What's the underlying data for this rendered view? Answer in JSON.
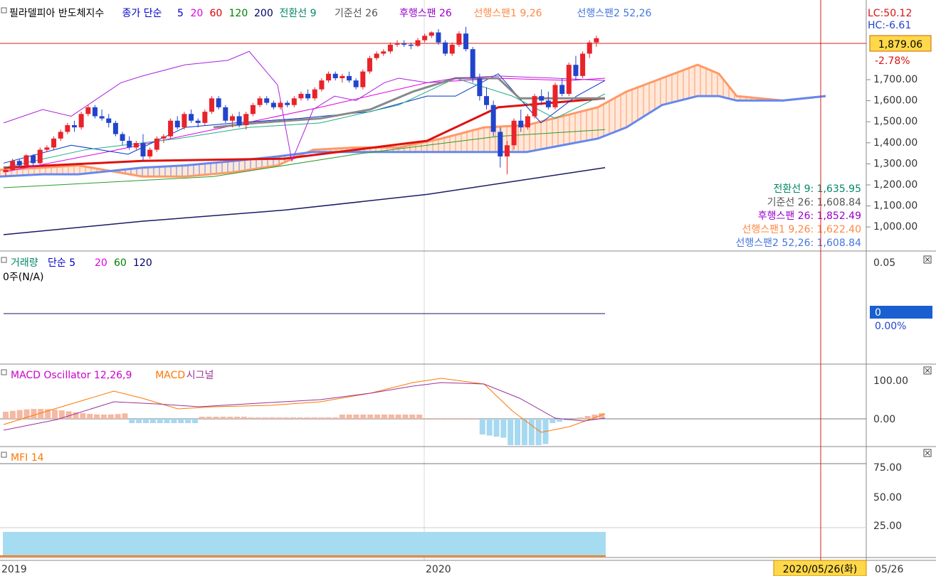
{
  "panes": {
    "price": {
      "legend": [
        {
          "text": "필라델피아 반도체지수",
          "color": "#000000"
        },
        {
          "text": "종가 단순",
          "color": "#0000cc"
        },
        {
          "text": "5",
          "color": "#0000cc"
        },
        {
          "text": "20",
          "color": "#e000e0"
        },
        {
          "text": "60",
          "color": "#e00000"
        },
        {
          "text": "120",
          "color": "#008000"
        },
        {
          "text": "200",
          "color": "#000066"
        },
        {
          "text": "전환선 9",
          "color": "#008866"
        },
        {
          "text": "기준선 26",
          "color": "#555555"
        },
        {
          "text": "후행스팬 26",
          "color": "#9900cc"
        },
        {
          "text": "선행스팬1 9,26",
          "color": "#ff8844"
        },
        {
          "text": "선행스팬2 52,26",
          "color": "#4477dd"
        }
      ],
      "lc": "LC:50.12",
      "hc": "HC:-6.61",
      "current_price": "1,879.06",
      "change_pct": "-2.78%",
      "y_ticks": [
        "1,700.00",
        "1,600.00",
        "1,500.00",
        "1,400.00",
        "1,300.00",
        "1,200.00",
        "1,100.00",
        "1,000.00"
      ],
      "values_box": [
        {
          "text": "전환선 9: 1,635.95",
          "color": "#008866"
        },
        {
          "text": "기준선 26: 1,608.84",
          "color": "#555555"
        },
        {
          "text": "후행스팬 26: 1,852.49",
          "color": "#9900cc"
        },
        {
          "text": "선행스팬1 9,26: 1,622.40",
          "color": "#ff8844"
        },
        {
          "text": "선행스팬2 52,26: 1,608.84",
          "color": "#4477dd"
        }
      ]
    },
    "volume": {
      "legend": [
        {
          "text": "거래량",
          "color": "#008866"
        },
        {
          "text": "단순 5",
          "color": "#0000cc"
        },
        {
          "text": "20",
          "color": "#e000e0"
        },
        {
          "text": "60",
          "color": "#008000"
        },
        {
          "text": "120",
          "color": "#000066"
        }
      ],
      "sub": "0주(N/A)",
      "y_tick": "0.05",
      "current": "0",
      "pct": "0.00%"
    },
    "macd": {
      "legend": [
        {
          "text": "MACD Oscillator 12,26,9",
          "color": "#cc00cc"
        },
        {
          "text": "MACD",
          "color": "#ff7700"
        },
        {
          "text": "시그널",
          "color": "#993399"
        }
      ],
      "y_ticks": [
        "100.00",
        "0.00"
      ]
    },
    "mfi": {
      "legend": [
        {
          "text": "MFI 14",
          "color": "#ff7700"
        }
      ],
      "y_ticks": [
        "75.00",
        "50.00",
        "25.00"
      ]
    }
  },
  "x_axis": {
    "labels": [
      "2019",
      "2020"
    ],
    "cursor_date": "2020/05/26(화)",
    "right_label": "05/26"
  },
  "colors": {
    "up": "#e8232a",
    "down": "#2244cc",
    "cursor": "#d02020",
    "grid": "#d8d8d8"
  },
  "chart_data": {
    "type": "candlestick",
    "candles": [
      [
        1280,
        1300,
        1260,
        1290
      ],
      [
        1290,
        1340,
        1285,
        1330
      ],
      [
        1330,
        1340,
        1300,
        1310
      ],
      [
        1310,
        1360,
        1300,
        1355
      ],
      [
        1355,
        1360,
        1310,
        1320
      ],
      [
        1320,
        1390,
        1315,
        1380
      ],
      [
        1380,
        1400,
        1370,
        1390
      ],
      [
        1390,
        1440,
        1380,
        1430
      ],
      [
        1430,
        1470,
        1420,
        1460
      ],
      [
        1460,
        1500,
        1450,
        1490
      ],
      [
        1490,
        1510,
        1460,
        1480
      ],
      [
        1480,
        1550,
        1470,
        1540
      ],
      [
        1540,
        1580,
        1530,
        1570
      ],
      [
        1570,
        1580,
        1520,
        1530
      ],
      [
        1530,
        1560,
        1510,
        1520
      ],
      [
        1520,
        1540,
        1480,
        1500
      ],
      [
        1500,
        1510,
        1440,
        1450
      ],
      [
        1450,
        1460,
        1400,
        1420
      ],
      [
        1420,
        1440,
        1380,
        1390
      ],
      [
        1390,
        1420,
        1380,
        1410
      ],
      [
        1410,
        1450,
        1330,
        1350
      ],
      [
        1350,
        1390,
        1340,
        1380
      ],
      [
        1380,
        1440,
        1370,
        1430
      ],
      [
        1430,
        1450,
        1410,
        1440
      ],
      [
        1440,
        1520,
        1430,
        1510
      ],
      [
        1510,
        1530,
        1470,
        1480
      ],
      [
        1480,
        1550,
        1470,
        1540
      ],
      [
        1540,
        1560,
        1500,
        1510
      ],
      [
        1510,
        1520,
        1480,
        1500
      ],
      [
        1500,
        1560,
        1490,
        1550
      ],
      [
        1550,
        1620,
        1540,
        1610
      ],
      [
        1610,
        1620,
        1560,
        1570
      ],
      [
        1570,
        1580,
        1500,
        1510
      ],
      [
        1510,
        1540,
        1480,
        1530
      ],
      [
        1530,
        1550,
        1480,
        1490
      ],
      [
        1490,
        1550,
        1470,
        1540
      ],
      [
        1540,
        1590,
        1530,
        1580
      ],
      [
        1580,
        1620,
        1570,
        1610
      ],
      [
        1610,
        1620,
        1580,
        1590
      ],
      [
        1590,
        1600,
        1560,
        1570
      ],
      [
        1570,
        1600,
        1560,
        1590
      ],
      [
        1590,
        1600,
        1570,
        1580
      ],
      [
        1580,
        1620,
        1570,
        1610
      ],
      [
        1610,
        1640,
        1600,
        1630
      ],
      [
        1630,
        1650,
        1600,
        1610
      ],
      [
        1610,
        1660,
        1600,
        1650
      ],
      [
        1650,
        1700,
        1640,
        1690
      ],
      [
        1690,
        1730,
        1680,
        1720
      ],
      [
        1720,
        1730,
        1690,
        1700
      ],
      [
        1700,
        1720,
        1680,
        1710
      ],
      [
        1710,
        1730,
        1680,
        1690
      ],
      [
        1690,
        1700,
        1650,
        1660
      ],
      [
        1660,
        1740,
        1650,
        1730
      ],
      [
        1730,
        1800,
        1720,
        1790
      ],
      [
        1790,
        1820,
        1780,
        1810
      ],
      [
        1810,
        1830,
        1800,
        1820
      ],
      [
        1820,
        1860,
        1810,
        1850
      ],
      [
        1850,
        1870,
        1840,
        1855
      ],
      [
        1855,
        1870,
        1840,
        1850
      ],
      [
        1850,
        1860,
        1830,
        1845
      ],
      [
        1845,
        1880,
        1840,
        1870
      ],
      [
        1870,
        1900,
        1860,
        1890
      ],
      [
        1890,
        1910,
        1880,
        1905
      ],
      [
        1905,
        1920,
        1850,
        1860
      ],
      [
        1860,
        1870,
        1800,
        1810
      ],
      [
        1810,
        1860,
        1800,
        1850
      ],
      [
        1850,
        1910,
        1840,
        1900
      ],
      [
        1900,
        1930,
        1820,
        1830
      ],
      [
        1830,
        1840,
        1680,
        1700
      ],
      [
        1700,
        1720,
        1600,
        1620
      ],
      [
        1620,
        1660,
        1560,
        1580
      ],
      [
        1580,
        1600,
        1440,
        1460
      ],
      [
        1460,
        1480,
        1300,
        1350
      ],
      [
        1350,
        1420,
        1270,
        1400
      ],
      [
        1400,
        1520,
        1380,
        1510
      ],
      [
        1510,
        1560,
        1460,
        1480
      ],
      [
        1480,
        1540,
        1470,
        1530
      ],
      [
        1530,
        1630,
        1520,
        1620
      ],
      [
        1620,
        1650,
        1580,
        1600
      ],
      [
        1600,
        1640,
        1560,
        1570
      ],
      [
        1570,
        1680,
        1560,
        1670
      ],
      [
        1670,
        1700,
        1620,
        1630
      ],
      [
        1630,
        1770,
        1620,
        1760
      ],
      [
        1760,
        1800,
        1690,
        1710
      ],
      [
        1710,
        1820,
        1700,
        1810
      ],
      [
        1810,
        1870,
        1790,
        1860
      ],
      [
        1860,
        1890,
        1840,
        1879
      ]
    ]
  }
}
